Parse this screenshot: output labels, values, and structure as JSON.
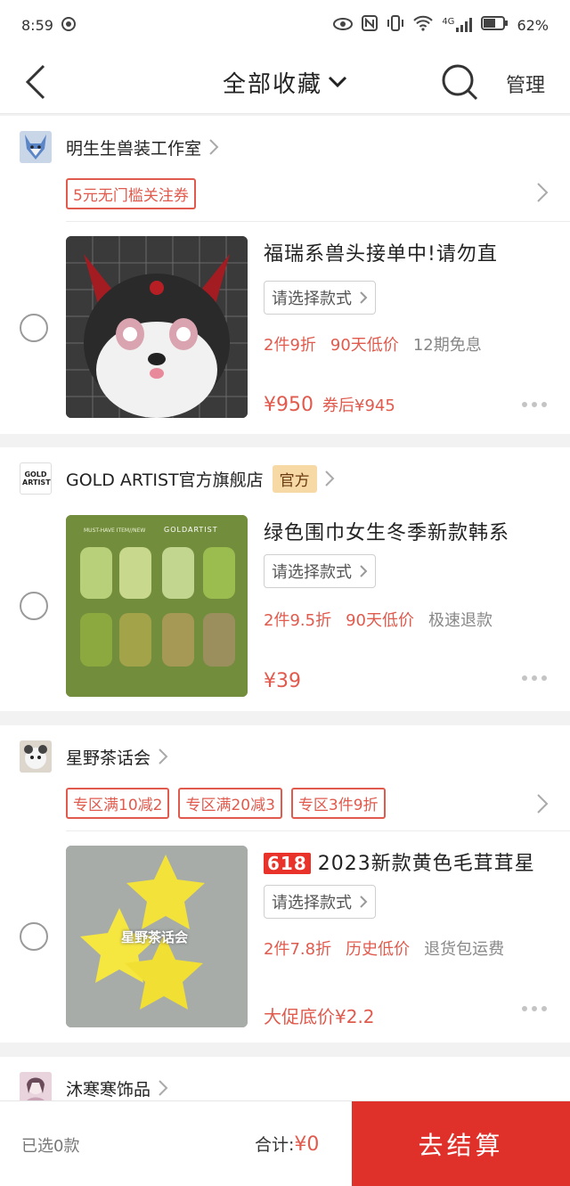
{
  "status_bar": {
    "time": "8:59",
    "network": "4G",
    "battery_pct": "62%",
    "battery_level": 0.62
  },
  "header": {
    "title": "全部收藏",
    "manage": "管理"
  },
  "stores": [
    {
      "name": "明生生兽装工作室",
      "coupons": [
        "5元无门槛关注券"
      ],
      "product": {
        "title": "福瑞系兽头接单中!请勿直",
        "variant": "请选择款式",
        "promos_red": [
          "2件9折",
          "90天低价"
        ],
        "promo_gray": "12期免息",
        "price": "¥950",
        "price_after": "券后¥945"
      }
    },
    {
      "name": "GOLD ARTIST官方旗舰店",
      "logo_text": "GOLD ARTIST",
      "badge": "官方",
      "product": {
        "title": "绿色围巾女生冬季新款韩系",
        "variant": "请选择款式",
        "promos_red": [
          "2件9.5折",
          "90天低价"
        ],
        "promo_gray": "极速退款",
        "price": "¥39",
        "image_header": "MUST-HAVE ITEM//NEW",
        "image_brand": "GOLDARTIST"
      }
    },
    {
      "name": "星野茶话会",
      "coupons": [
        "专区满10减2",
        "专区满20减3",
        "专区3件9折"
      ],
      "product": {
        "tag": "618",
        "title": "2023新款黄色毛茸茸星",
        "variant": "请选择款式",
        "promos_red": [
          "2件7.8折",
          "历史低价"
        ],
        "promo_gray": "退货包运费",
        "price": "大促底价¥2.2",
        "image_watermark": "星野茶话会"
      }
    },
    {
      "name": "沐寒寒饰品"
    }
  ],
  "bottom_bar": {
    "selected": "已选0款",
    "total_label": "合计:",
    "total_amount": "¥0",
    "checkout": "去结算"
  },
  "colors": {
    "accent_red": "#e0302a",
    "promo_red": "#e05a4d",
    "official_badge": "#f7d9a6"
  }
}
